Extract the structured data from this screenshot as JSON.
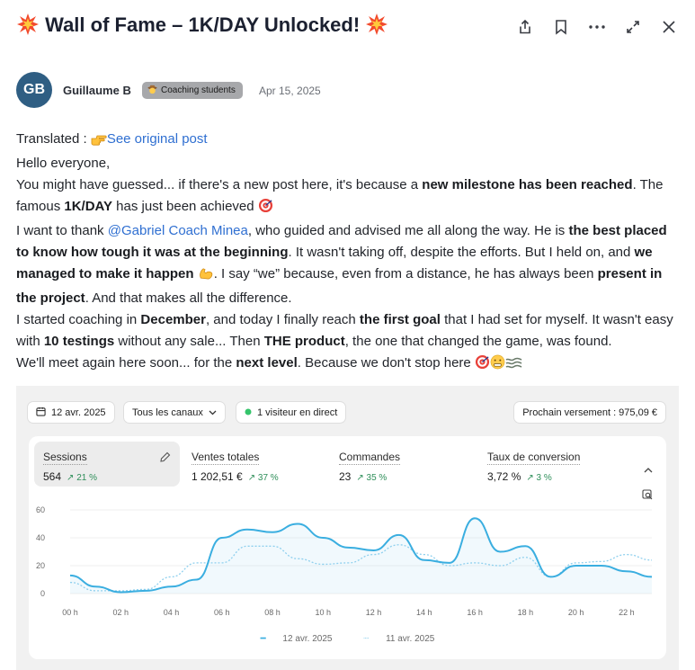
{
  "post": {
    "title_prefix_emoji": "💥",
    "title": "Wall of Fame – 1K/DAY Unlocked!",
    "title_suffix_emoji": "💥",
    "actions": [
      "share-icon",
      "bookmark-icon",
      "more-icon",
      "expand-icon",
      "close-icon"
    ]
  },
  "author": {
    "initials": "GB",
    "name": "Guillaume B",
    "badge": "Coaching students",
    "date": "Apr 15, 2025"
  },
  "content": {
    "translated_label": "Translated : ",
    "see_original": "See original post",
    "l1": "Hello everyone,",
    "l2a": "You might have guessed... if there's a new post here, it's because a ",
    "l2b": "new milestone has been reached",
    "l2c": ". The famous ",
    "l2d": "1K/DAY",
    "l2e": " has just been achieved ",
    "l3a": "I want to thank ",
    "l3b": "@Gabriel Coach Minea",
    "l3c": ", who guided and advised me all along the way. He is ",
    "l3d": "the best placed to know how tough it was at the beginning",
    "l3e": ". It wasn't taking off, despite the efforts. But I held on, and ",
    "l3f": "we managed to make it happen",
    "l3g": ". I say “we” because, even from a distance, he has always been ",
    "l3h": "present in the project",
    "l3i": ". And that makes all the difference.",
    "l4a": "I started coaching in ",
    "l4b": "December",
    "l4c": ", and today I finally reach ",
    "l4d": "the first goal",
    "l4e": " that I had set for myself. It wasn't easy with ",
    "l4f": "10 testings",
    "l4g": " without any sale... Then ",
    "l4h": "THE product",
    "l4i": ", the one that changed the game, was found.",
    "l5a": "We'll meet again here soon... for the ",
    "l5b": "next level",
    "l5c": ". Because we don't stop here "
  },
  "dashboard": {
    "date_pill": "12 avr. 2025",
    "channels_pill": "Tous les canaux",
    "visitors_pill": "1 visiteur en direct",
    "payout_pill": "Prochain versement : 975,09 €",
    "metrics": [
      {
        "label": "Sessions",
        "value": "564",
        "change": "↗ 21 %"
      },
      {
        "label": "Ventes totales",
        "value": "1 202,51 €",
        "change": "↗ 37 %"
      },
      {
        "label": "Commandes",
        "value": "23",
        "change": "↗ 35 %"
      },
      {
        "label": "Taux de conversion",
        "value": "3,72 %",
        "change": "↗ 3 %"
      }
    ],
    "legend_current": "12 avr. 2025",
    "legend_previous": "11 avr. 2025",
    "colors": {
      "current": "#3aaee0",
      "previous": "#8fd0ee",
      "up": "#2f8f5a"
    }
  },
  "chart_data": {
    "type": "line",
    "x": [
      "00 h",
      "01 h",
      "02 h",
      "03 h",
      "04 h",
      "05 h",
      "06 h",
      "07 h",
      "08 h",
      "09 h",
      "10 h",
      "11 h",
      "12 h",
      "13 h",
      "14 h",
      "15 h",
      "16 h",
      "17 h",
      "18 h",
      "19 h",
      "20 h",
      "21 h",
      "22 h",
      "23 h"
    ],
    "x_ticks": [
      "00 h",
      "02 h",
      "04 h",
      "06 h",
      "08 h",
      "10 h",
      "12 h",
      "14 h",
      "16 h",
      "18 h",
      "20 h",
      "22 h"
    ],
    "y_ticks": [
      "0",
      "20",
      "40",
      "60"
    ],
    "ylim": [
      0,
      60
    ],
    "series": [
      {
        "name": "12 avr. 2025",
        "values": [
          13,
          5,
          1,
          2,
          5,
          10,
          40,
          46,
          44,
          50,
          40,
          33,
          31,
          42,
          24,
          22,
          54,
          30,
          34,
          12,
          20,
          20,
          16,
          12
        ]
      },
      {
        "name": "11 avr. 2025",
        "values": [
          8,
          2,
          2,
          3,
          12,
          22,
          22,
          34,
          34,
          25,
          21,
          22,
          28,
          35,
          28,
          20,
          22,
          20,
          26,
          12,
          22,
          23,
          28,
          24
        ]
      }
    ]
  }
}
